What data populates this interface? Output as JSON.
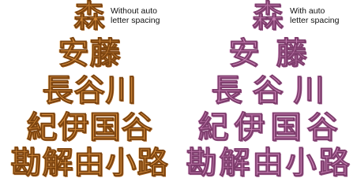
{
  "labels": {
    "left": [
      "Without auto",
      "letter spacing"
    ],
    "right": [
      "With auto",
      "letter spacing"
    ]
  },
  "rows": [
    [
      "森"
    ],
    [
      "安",
      "藤"
    ],
    [
      "長",
      "谷",
      "川"
    ],
    [
      "紀",
      "伊",
      "国",
      "谷"
    ],
    [
      "勘",
      "解",
      "由",
      "小",
      "路"
    ]
  ],
  "colors": {
    "left_thread": "#d48a3a",
    "right_thread": "#c77fb2"
  }
}
